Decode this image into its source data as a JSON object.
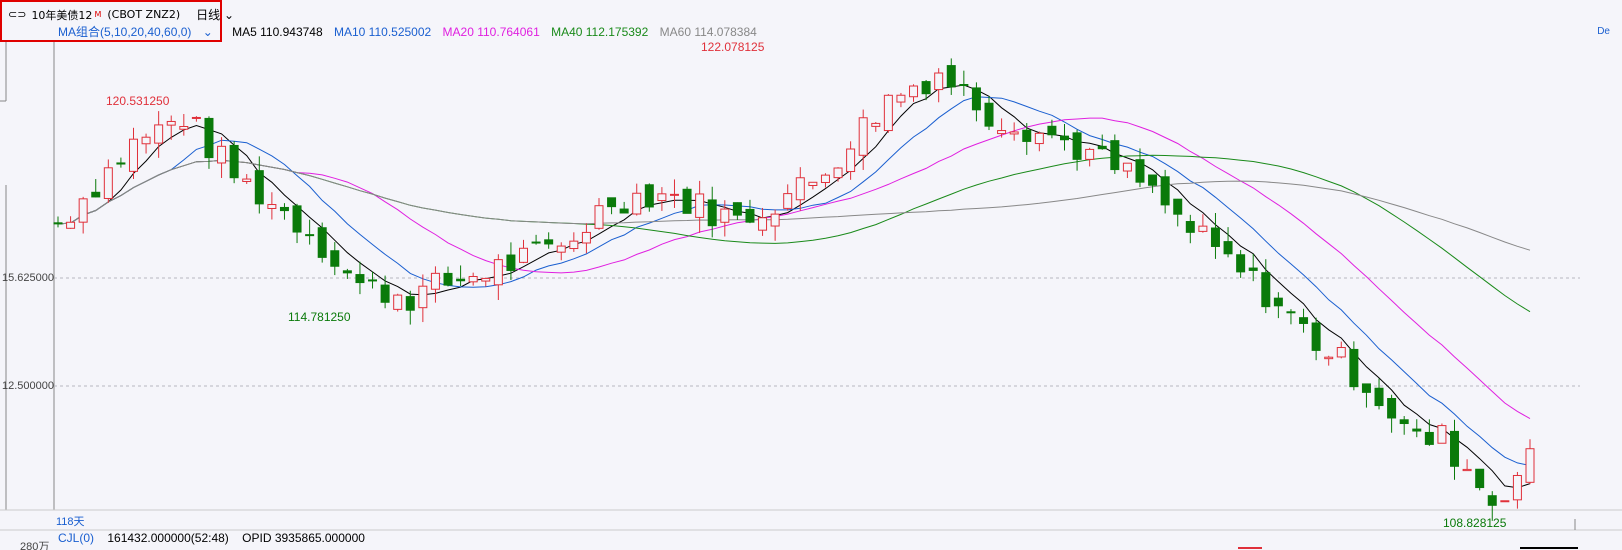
{
  "header": {
    "instrument_name": "10年美债12",
    "instrument_sup": "M",
    "instrument_code": "(CBOT ZNZ2)",
    "period": "日线"
  },
  "ma_legend": {
    "group_label": "MA组合(5,10,20,40,60,0)",
    "ma5": "MA5 110.943748",
    "ma10": "MA10 110.525002",
    "ma20": "MA20 110.764061",
    "ma40": "MA40 112.175392",
    "ma60": "MA60 114.078384"
  },
  "colors": {
    "up": "#e0303a",
    "down": "#0a7a0a",
    "ma5": "#000000",
    "ma10": "#1a5fd0",
    "ma20": "#e020e0",
    "ma40": "#1a8a1a",
    "ma60": "#888888"
  },
  "annotations": {
    "high_1": "120.531250",
    "low_1": "114.781250",
    "high_2": "122.078125",
    "low_2": "108.828125"
  },
  "axis": {
    "tick_1": "15.625000",
    "tick_2": "12.500000",
    "days": "118天",
    "volume_unit": "280万"
  },
  "footer": {
    "cjl": "CJL(0)",
    "volume": "161432.000000(52:48)",
    "opid": "OPID 3935865.000000"
  },
  "corner_text": "De"
}
